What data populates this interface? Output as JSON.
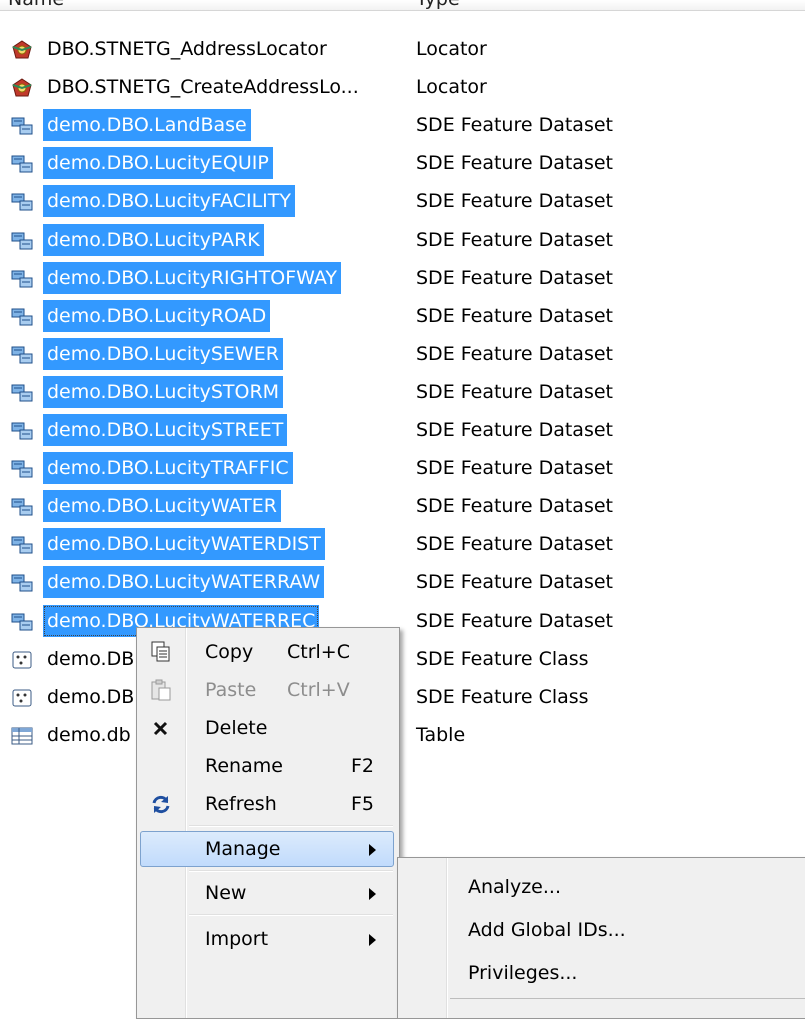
{
  "header": {
    "name_col": "Name",
    "type_col": "Type"
  },
  "rows": [
    {
      "name": "DBO.STNETG_AddressLocator",
      "type": "Locator",
      "icon": "locator-icon",
      "selected": false
    },
    {
      "name": "DBO.STNETG_CreateAddressLo...",
      "type": "Locator",
      "icon": "locator-icon",
      "selected": false
    },
    {
      "name": "demo.DBO.LandBase",
      "type": "SDE Feature Dataset",
      "icon": "feature-dataset-icon",
      "selected": true
    },
    {
      "name": "demo.DBO.LucityEQUIP",
      "type": "SDE Feature Dataset",
      "icon": "feature-dataset-icon",
      "selected": true
    },
    {
      "name": "demo.DBO.LucityFACILITY",
      "type": "SDE Feature Dataset",
      "icon": "feature-dataset-icon",
      "selected": true
    },
    {
      "name": "demo.DBO.LucityPARK",
      "type": "SDE Feature Dataset",
      "icon": "feature-dataset-icon",
      "selected": true
    },
    {
      "name": "demo.DBO.LucityRIGHTOFWAY",
      "type": "SDE Feature Dataset",
      "icon": "feature-dataset-icon",
      "selected": true
    },
    {
      "name": "demo.DBO.LucityROAD",
      "type": "SDE Feature Dataset",
      "icon": "feature-dataset-icon",
      "selected": true
    },
    {
      "name": "demo.DBO.LucitySEWER",
      "type": "SDE Feature Dataset",
      "icon": "feature-dataset-icon",
      "selected": true
    },
    {
      "name": "demo.DBO.LucitySTORM",
      "type": "SDE Feature Dataset",
      "icon": "feature-dataset-icon",
      "selected": true
    },
    {
      "name": "demo.DBO.LucitySTREET",
      "type": "SDE Feature Dataset",
      "icon": "feature-dataset-icon",
      "selected": true
    },
    {
      "name": "demo.DBO.LucityTRAFFIC",
      "type": "SDE Feature Dataset",
      "icon": "feature-dataset-icon",
      "selected": true
    },
    {
      "name": "demo.DBO.LucityWATER",
      "type": "SDE Feature Dataset",
      "icon": "feature-dataset-icon",
      "selected": true
    },
    {
      "name": "demo.DBO.LucityWATERDIST",
      "type": "SDE Feature Dataset",
      "icon": "feature-dataset-icon",
      "selected": true
    },
    {
      "name": "demo.DBO.LucityWATERRAW",
      "type": "SDE Feature Dataset",
      "icon": "feature-dataset-icon",
      "selected": true
    },
    {
      "name": "demo.DBO.LucityWATERREC",
      "type": "SDE Feature Dataset",
      "icon": "feature-dataset-icon",
      "selected": true,
      "focused": true
    },
    {
      "name": "demo.DB",
      "type": "SDE Feature Class",
      "icon": "point-feature-class-icon",
      "selected": false
    },
    {
      "name": "demo.DB",
      "type": "SDE Feature Class",
      "icon": "point-feature-class-icon",
      "selected": false
    },
    {
      "name": "demo.db",
      "type": "Table",
      "icon": "table-icon",
      "selected": false
    }
  ],
  "context_menu": {
    "items": [
      {
        "label": "Copy",
        "shortcut": "Ctrl+C",
        "icon": "copy-icon",
        "disabled": false
      },
      {
        "label": "Paste",
        "shortcut": "Ctrl+V",
        "icon": "paste-icon",
        "disabled": true
      },
      {
        "label": "Delete",
        "shortcut": "",
        "icon": "delete-icon",
        "disabled": false
      },
      {
        "label": "Rename",
        "shortcut": "F2",
        "icon": "",
        "disabled": false
      },
      {
        "label": "Refresh",
        "shortcut": "F5",
        "icon": "refresh-icon",
        "disabled": false
      },
      {
        "label": "Manage",
        "shortcut": "",
        "icon": "",
        "submenu": true,
        "highlighted": true
      },
      {
        "label": "New",
        "shortcut": "",
        "icon": "",
        "submenu": true
      },
      {
        "label": "Import",
        "shortcut": "",
        "icon": "",
        "submenu": true
      }
    ]
  },
  "manage_submenu": {
    "items": [
      {
        "label": "Analyze..."
      },
      {
        "label": "Add Global IDs..."
      },
      {
        "label": "Privileges..."
      }
    ]
  }
}
